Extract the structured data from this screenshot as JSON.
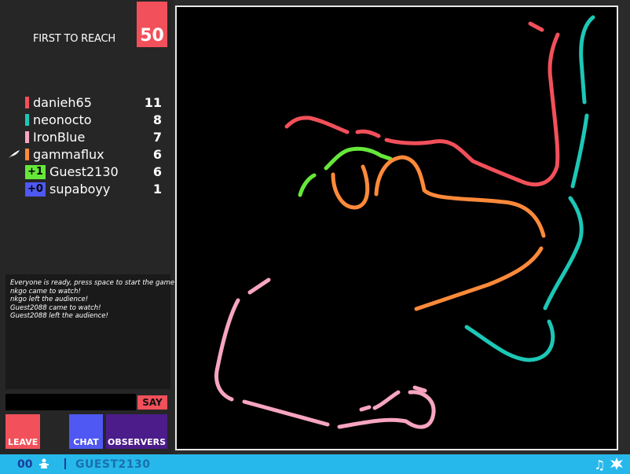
{
  "header": {
    "reach_label": "FIRST TO REACH",
    "reach_score": "50"
  },
  "players": [
    {
      "name": "danieh65",
      "score": "11",
      "color": "#f2505a"
    },
    {
      "name": "neonocto",
      "score": "8",
      "color": "#1dc7b6"
    },
    {
      "name": "IronBlue",
      "score": "7",
      "color": "#f7a5c1"
    },
    {
      "name": "gammaflux",
      "score": "6",
      "color": "#ff8a3a",
      "icon": "feather-icon"
    },
    {
      "name": "Guest2130",
      "score": "6",
      "color": "#66e83a",
      "delta": "+1"
    },
    {
      "name": "supaboyy",
      "score": "1",
      "color": "#4f58f2",
      "delta": "+0"
    }
  ],
  "chat": {
    "messages": [
      "Everyone is ready, press space to start the game",
      "nkgo came to watch!",
      "nkgo left the audience!",
      "Guest2088 came to watch!",
      "Guest2088 left the audience!"
    ],
    "input_value": "",
    "say_label": "SAY"
  },
  "buttons": {
    "leave": "LEAVE",
    "chat": "CHAT",
    "observers": "OBSERVERS"
  },
  "status_bar": {
    "viewer_count": "00",
    "username": "GUEST2130",
    "music_icon": "♫"
  },
  "colors": {
    "accent_red": "#f2505a",
    "status_bar": "#26b8ea",
    "arena_bg": "#000000"
  }
}
